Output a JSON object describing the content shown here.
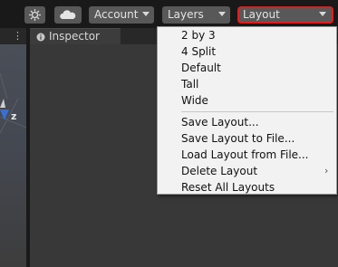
{
  "toolbar": {
    "account_label": "Account",
    "layers_label": "Layers",
    "layout_label": "Layout",
    "highlight_color": "#e01e1e"
  },
  "tabs": {
    "inspector_label": "Inspector"
  },
  "scene": {
    "axis_label": "z"
  },
  "layout_menu": {
    "items": [
      {
        "label": "2 by 3"
      },
      {
        "label": "4 Split"
      },
      {
        "label": "Default"
      },
      {
        "label": "Tall"
      },
      {
        "label": "Wide"
      },
      {
        "label": "Save Layout..."
      },
      {
        "label": "Save Layout to File..."
      },
      {
        "label": "Load Layout from File..."
      },
      {
        "label": "Delete Layout",
        "has_submenu": true
      },
      {
        "label": "Reset All Layouts"
      }
    ]
  }
}
